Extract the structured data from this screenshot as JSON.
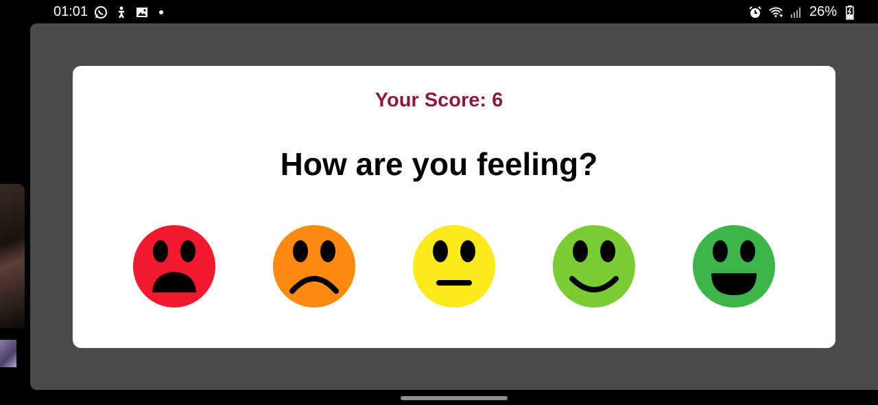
{
  "status_bar": {
    "time": "01:01",
    "battery": "26%",
    "icons_left": [
      "whatsapp-icon",
      "accessibility-icon",
      "image-icon",
      "notification-dot"
    ],
    "icons_right": [
      "alarm-icon",
      "wifi-icon",
      "signal-icon",
      "battery-charging-icon"
    ]
  },
  "dialog": {
    "score_text": "Your Score: 6",
    "question": "How are you feeling?",
    "colors": {
      "score": "#8a1845",
      "question": "#000000"
    },
    "moods": [
      {
        "name": "very-sad",
        "color": "#f21b2d"
      },
      {
        "name": "sad",
        "color": "#fb8a12"
      },
      {
        "name": "neutral",
        "color": "#fde91c"
      },
      {
        "name": "happy",
        "color": "#7acc34"
      },
      {
        "name": "very-happy",
        "color": "#3cb54a"
      }
    ]
  }
}
